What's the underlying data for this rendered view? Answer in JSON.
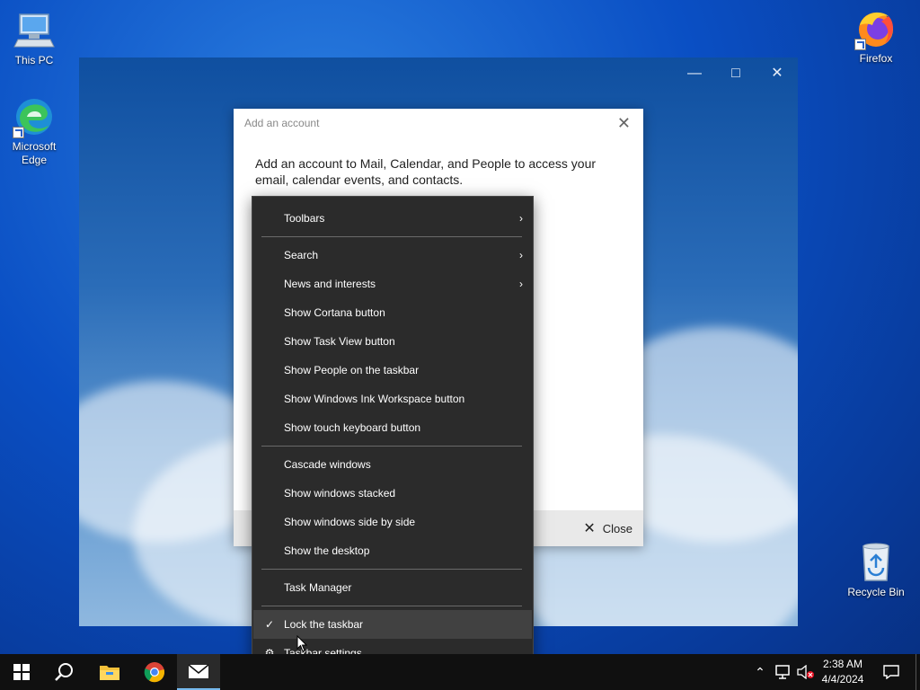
{
  "desktop": {
    "icons": [
      {
        "label": "This PC",
        "icon": "computer-icon"
      },
      {
        "label": "Microsoft Edge",
        "label_line1": "Microsoft",
        "label_line2": "Edge",
        "icon": "edge-icon"
      },
      {
        "label": "Firefox",
        "icon": "firefox-icon"
      },
      {
        "label": "Recycle Bin",
        "icon": "recycle-bin-icon"
      }
    ]
  },
  "dialog": {
    "title": "Add an account",
    "body": "Add an account to Mail, Calendar, and People to access your email, calendar events, and contacts.",
    "close_label": "Close"
  },
  "context_menu": {
    "items": [
      {
        "label": "Toolbars",
        "submenu": true
      },
      {
        "label": "Search",
        "submenu": true
      },
      {
        "label": "News and interests",
        "submenu": true
      },
      {
        "label": "Show Cortana button"
      },
      {
        "label": "Show Task View button"
      },
      {
        "label": "Show People on the taskbar"
      },
      {
        "label": "Show Windows Ink Workspace button"
      },
      {
        "label": "Show touch keyboard button"
      },
      {
        "label": "Cascade windows"
      },
      {
        "label": "Show windows stacked"
      },
      {
        "label": "Show windows side by side"
      },
      {
        "label": "Show the desktop"
      },
      {
        "label": "Task Manager"
      },
      {
        "label": "Lock the taskbar",
        "checked": true,
        "hovered": true
      },
      {
        "label": "Taskbar settings",
        "icon": "gear-icon"
      }
    ]
  },
  "taskbar": {
    "apps": [
      "start-icon",
      "search-icon",
      "file-explorer-icon",
      "chrome-icon",
      "mail-icon"
    ],
    "clock": {
      "time": "2:38 AM",
      "date": "4/4/2024"
    }
  },
  "colors": {
    "menu_bg": "#2b2b2b",
    "menu_hover": "#414141",
    "taskbar_bg": "#101010",
    "desktop_accent": "#0a4fc4"
  }
}
